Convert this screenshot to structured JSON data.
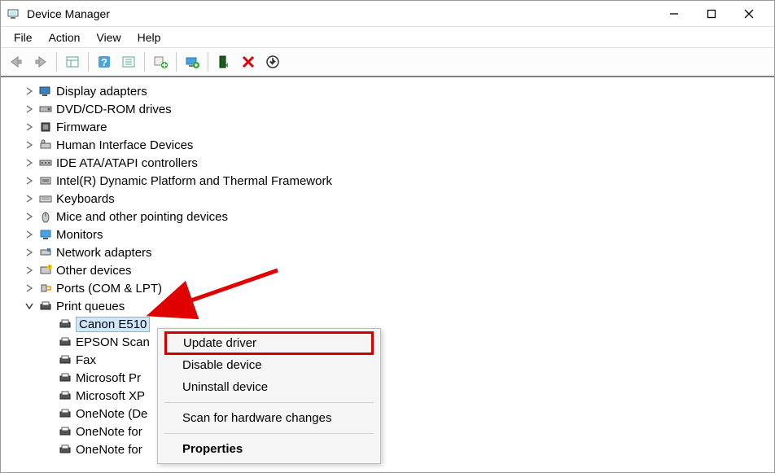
{
  "window": {
    "title": "Device Manager"
  },
  "menubar": {
    "file": "File",
    "action": "Action",
    "view": "View",
    "help": "Help"
  },
  "tree": {
    "items": [
      {
        "label": "Display adapters"
      },
      {
        "label": "DVD/CD-ROM drives"
      },
      {
        "label": "Firmware"
      },
      {
        "label": "Human Interface Devices"
      },
      {
        "label": "IDE ATA/ATAPI controllers"
      },
      {
        "label": "Intel(R) Dynamic Platform and Thermal Framework"
      },
      {
        "label": "Keyboards"
      },
      {
        "label": "Mice and other pointing devices"
      },
      {
        "label": "Monitors"
      },
      {
        "label": "Network adapters"
      },
      {
        "label": "Other devices"
      },
      {
        "label": "Ports (COM & LPT)"
      },
      {
        "label": "Print queues"
      }
    ],
    "print_queue_children": [
      {
        "label": "Canon E510"
      },
      {
        "label": "EPSON Scan"
      },
      {
        "label": "Fax"
      },
      {
        "label": "Microsoft Pr"
      },
      {
        "label": "Microsoft XP"
      },
      {
        "label": "OneNote (De"
      },
      {
        "label": "OneNote for"
      },
      {
        "label": "OneNote for"
      }
    ]
  },
  "context_menu": {
    "update": "Update driver",
    "disable": "Disable device",
    "uninstall": "Uninstall device",
    "scan": "Scan for hardware changes",
    "properties": "Properties"
  }
}
